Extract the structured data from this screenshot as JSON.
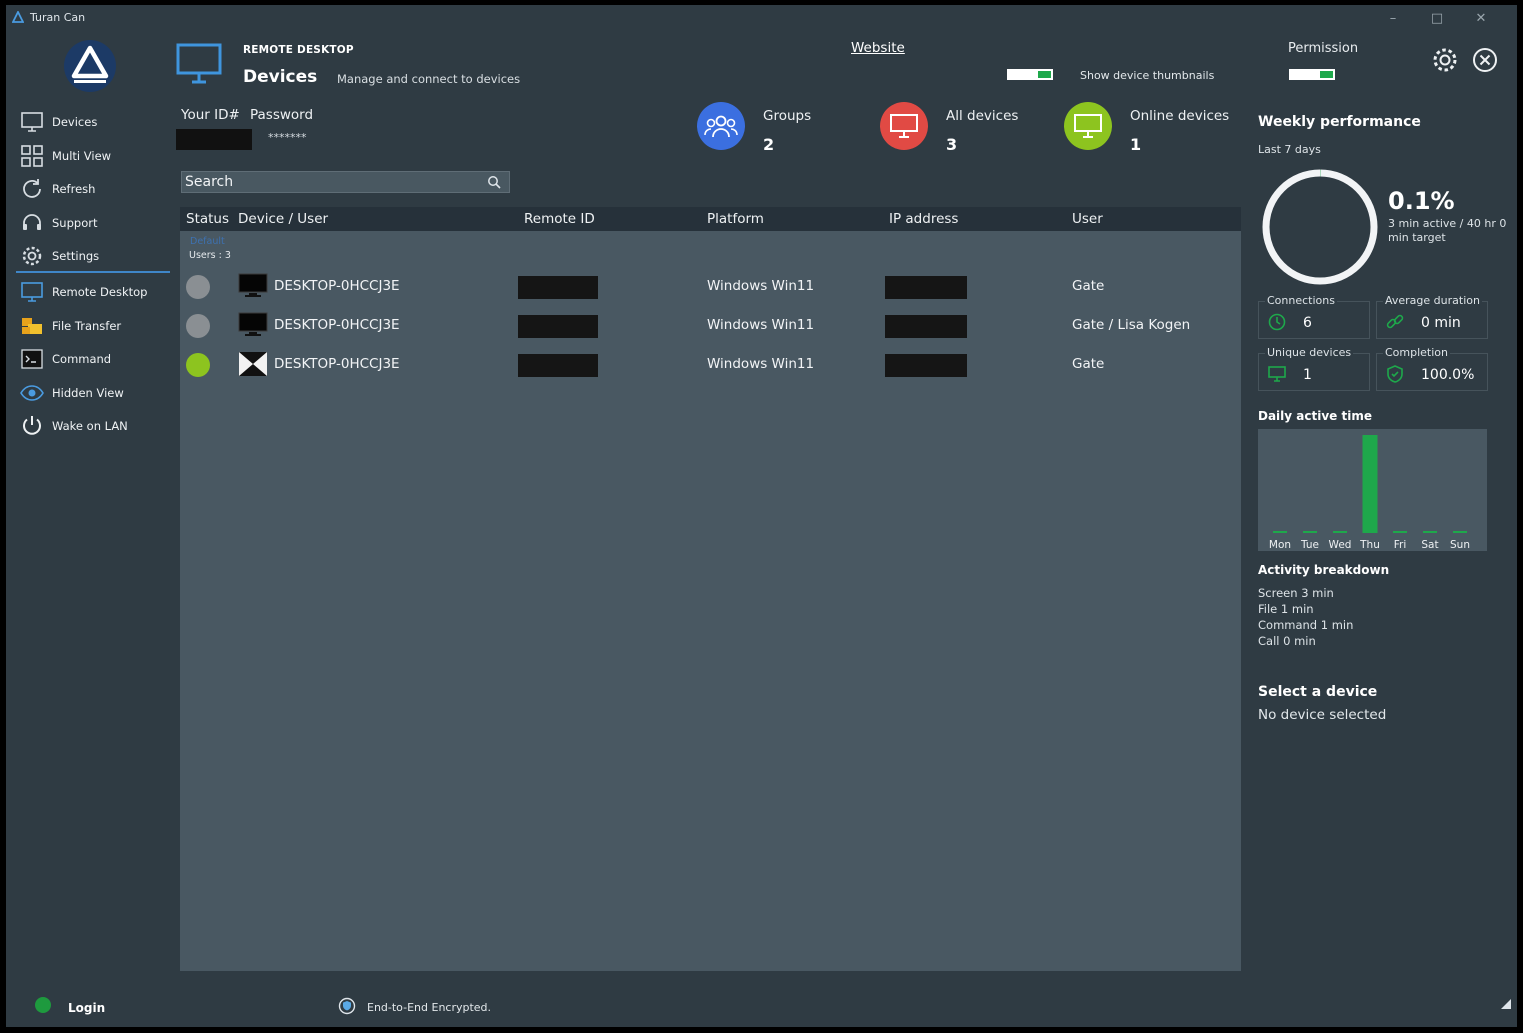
{
  "window": {
    "title": "Turan Can"
  },
  "sidebar": {
    "items": [
      {
        "label": "Devices",
        "icon": "monitor-icon"
      },
      {
        "label": "Multi View",
        "icon": "grid-icon"
      },
      {
        "label": "Refresh",
        "icon": "refresh-icon"
      },
      {
        "label": "Support",
        "icon": "headset-icon"
      },
      {
        "label": "Settings",
        "icon": "gear-icon"
      },
      {
        "label": "Remote Desktop",
        "icon": "monitor-icon"
      },
      {
        "label": "File Transfer",
        "icon": "folder-icon"
      },
      {
        "label": "Command",
        "icon": "terminal-icon"
      },
      {
        "label": "Hidden View",
        "icon": "eye-icon"
      },
      {
        "label": "Wake on LAN",
        "icon": "power-icon"
      }
    ]
  },
  "header": {
    "section": "REMOTE DESKTOP",
    "title": "Devices",
    "subtitle": "Manage and connect to devices",
    "website": "Website",
    "thumbnails_label": "Show device thumbnails",
    "permission_label": "Permission"
  },
  "credentials": {
    "id_label": "Your ID#",
    "password_label": "Password",
    "password_value": "*******"
  },
  "search": {
    "placeholder": "Search"
  },
  "stats": [
    {
      "label": "Groups",
      "value": "2",
      "color": "#3b6fe0",
      "icon": "users-icon"
    },
    {
      "label": "All devices",
      "value": "3",
      "color": "#e14a44",
      "icon": "monitor-icon"
    },
    {
      "label": "Online devices",
      "value": "1",
      "color": "#8dc41f",
      "icon": "monitor-icon"
    }
  ],
  "table": {
    "columns": [
      "Status",
      "Device / User",
      "Remote ID",
      "Platform",
      "IP address",
      "User"
    ],
    "group": {
      "name": "Default",
      "users": "Users : 3"
    },
    "rows": [
      {
        "status": "offline",
        "device": "DESKTOP-0HCCJ3E",
        "platform": "Windows  Win11",
        "user": "Gate"
      },
      {
        "status": "offline",
        "device": "DESKTOP-0HCCJ3E",
        "platform": "Windows  Win11",
        "user": "Gate / Lisa Kogen"
      },
      {
        "status": "online",
        "device": "DESKTOP-0HCCJ3E",
        "platform": "Windows  Win11",
        "user": "Gate"
      }
    ]
  },
  "performance": {
    "title": "Weekly performance",
    "period": "Last 7 days",
    "percent": "0.1%",
    "detail": "3 min active / 40 hr 0 min target",
    "progress_fraction": 0.001,
    "cards": [
      {
        "label": "Connections",
        "value": "6",
        "icon": "clock-icon"
      },
      {
        "label": "Average duration",
        "value": "0 min",
        "icon": "link-icon"
      },
      {
        "label": "Unique devices",
        "value": "1",
        "icon": "monitor-icon"
      },
      {
        "label": "Completion",
        "value": "100.0%",
        "icon": "shield-icon"
      }
    ],
    "daily_title": "Daily active time",
    "breakdown_title": "Activity breakdown",
    "breakdown": [
      "Screen  3 min",
      "File  1 min",
      "Command  1 min",
      "Call  0 min"
    ]
  },
  "chart_data": {
    "type": "bar",
    "categories": [
      "Mon",
      "Tue",
      "Wed",
      "Thu",
      "Fri",
      "Sat",
      "Sun"
    ],
    "values": [
      0.02,
      0.02,
      0.02,
      1,
      0.02,
      0.02,
      0.02
    ],
    "title": "Daily active time",
    "bar_color": "#1ea84b"
  },
  "selection": {
    "title": "Select a device",
    "subtitle": "No device selected"
  },
  "footer": {
    "login": "Login",
    "encryption": "End-to-End Encrypted."
  },
  "colors": {
    "accent": "#3f86c8",
    "online": "#8dc41f",
    "offline": "#8a8f93",
    "success": "#1ea84b"
  }
}
